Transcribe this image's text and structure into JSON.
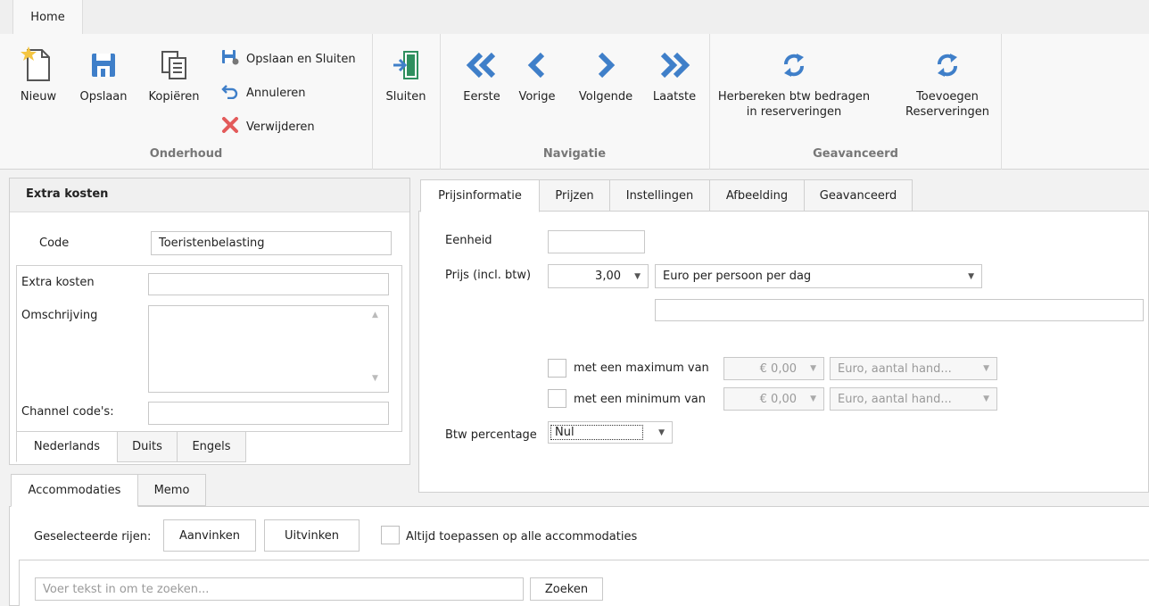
{
  "ribbon": {
    "tab_home": "Home",
    "nieuw": "Nieuw",
    "opslaan": "Opslaan",
    "kopieren": "Kopiëren",
    "opslaan_sluiten": "Opslaan en Sluiten",
    "annuleren": "Annuleren",
    "verwijderen": "Verwijderen",
    "sluiten": "Sluiten",
    "eerste": "Eerste",
    "vorige": "Vorige",
    "volgende": "Volgende",
    "laatste": "Laatste",
    "herbereken_line1": "Herbereken btw bedragen",
    "herbereken_line2": "in reserveringen",
    "toevoegen_line1": "Toevoegen",
    "toevoegen_line2": "Reserveringen",
    "group_onderhoud": "Onderhoud",
    "group_navigatie": "Navigatie",
    "group_geavanceerd": "Geavanceerd"
  },
  "left": {
    "title": "Extra kosten",
    "code_label": "Code",
    "code_value": "Toeristenbelasting",
    "extra_kosten_label": "Extra kosten",
    "extra_kosten_value": "",
    "omschrijving_label": "Omschrijving",
    "channel_label": "Channel code's:",
    "channel_value": "",
    "lang_tabs": [
      "Nederlands",
      "Duits",
      "Engels"
    ]
  },
  "right": {
    "tabs": [
      "Prijsinformatie",
      "Prijzen",
      "Instellingen",
      "Afbeelding",
      "Geavanceerd"
    ],
    "eenheid_label": "Eenheid",
    "eenheid_value": "",
    "prijs_label": "Prijs (incl. btw)",
    "prijs_value": "3,00",
    "prijs_unit": "Euro per persoon per dag",
    "extra_value": "",
    "max_label": "met een maximum van",
    "max_amount": "€ 0,00",
    "max_unit": "Euro, aantal hand...",
    "min_label": "met een minimum van",
    "min_amount": "€ 0,00",
    "min_unit": "Euro, aantal hand...",
    "btw_label": "Btw percentage",
    "btw_value": "Nul"
  },
  "bottom": {
    "tabs": [
      "Accommodaties",
      "Memo"
    ],
    "geselecteerde_label": "Geselecteerde rijen:",
    "aanvinken": "Aanvinken",
    "uitvinken": "Uitvinken",
    "altijd_label": "Altijd toepassen op alle accommodaties",
    "search_placeholder": "Voer tekst in om te zoeken...",
    "zoeken": "Zoeken"
  },
  "colors": {
    "accent_blue": "#3f7fc9",
    "delete_red": "#e35b5b",
    "star_yellow": "#f4c542"
  }
}
